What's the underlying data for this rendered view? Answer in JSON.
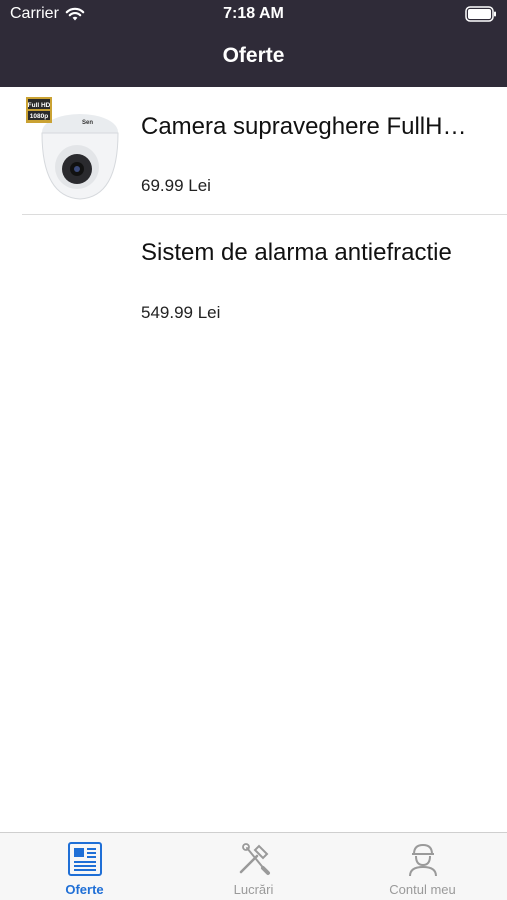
{
  "status_bar": {
    "carrier": "Carrier",
    "time": "7:18 AM"
  },
  "nav": {
    "title": "Oferte"
  },
  "offers": [
    {
      "title": "Camera supraveghere FullH…",
      "price": "69.99 Lei",
      "thumb_icon": "dome-camera-image",
      "badge_line1": "Full HD",
      "badge_line2": "1080p"
    },
    {
      "title": "Sistem de alarma antiefractie",
      "price": "549.99 Lei",
      "thumb_icon": ""
    }
  ],
  "tabs": [
    {
      "label": "Oferte",
      "icon": "newspaper-icon",
      "active": true
    },
    {
      "label": "Lucrări",
      "icon": "tools-icon",
      "active": false
    },
    {
      "label": "Contul meu",
      "icon": "worker-icon",
      "active": false
    }
  ],
  "colors": {
    "topbar_bg": "#2f2b38",
    "tab_active": "#1f6fd6",
    "tab_inactive": "#9a9a9a"
  }
}
